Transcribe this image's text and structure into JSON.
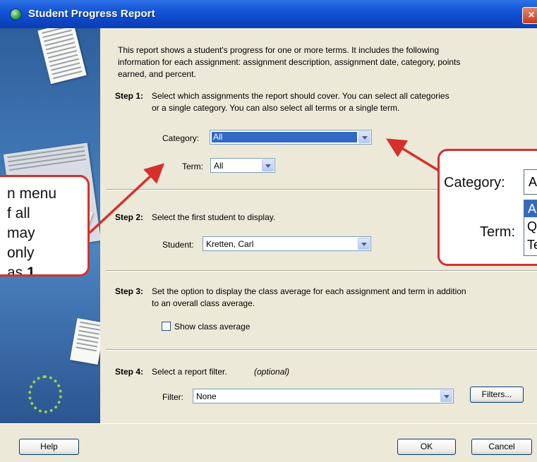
{
  "window": {
    "title": "Student Progress Report",
    "close_label": "×"
  },
  "intro": {
    "line1": "This report shows a student's progress for one or more terms.  It includes the following",
    "line2": "information for each assignment: assignment description, assignment date, category, points",
    "line3": "earned, and percent."
  },
  "step1": {
    "label": "Step 1:",
    "line1": "Select which assignments the report should cover. You can select all categories",
    "line2": "or a single category.  You can also select all terms or a single term.",
    "category_label": "Category:",
    "category_value": "All",
    "term_label": "Term:",
    "term_value": "All"
  },
  "step2": {
    "label": "Step 2:",
    "text": "Select the first student to display.",
    "student_label": "Student:",
    "student_value": "Kretten, Carl"
  },
  "step3": {
    "label": "Step 3:",
    "line1": "Set the option to display the class average for each assignment and term in addition",
    "line2": "to an overall class average.",
    "checkbox_label": "Show class average"
  },
  "step4": {
    "label": "Step 4:",
    "text": "Select a report filter.",
    "optional": "(optional)",
    "filter_label": "Filter:",
    "filter_value": "None",
    "filters_button": "Filters..."
  },
  "buttons": {
    "help": "Help",
    "ok": "OK",
    "cancel": "Cancel"
  },
  "callout_left": {
    "line1": "n menu",
    "line2": "f all",
    "line3": "may",
    "line4": "only",
    "line5_pre": "as ",
    "line5_bold": "1",
    "line5_post": "."
  },
  "callout_right": {
    "category_label": "Category:",
    "term_label": "Term:",
    "combo_value": "A",
    "option1": "A",
    "option2": "Q",
    "option3": "Te"
  },
  "colors": {
    "title_bar": "#0c47c6",
    "callout_border": "#d7302c",
    "selection": "#316ac5"
  }
}
